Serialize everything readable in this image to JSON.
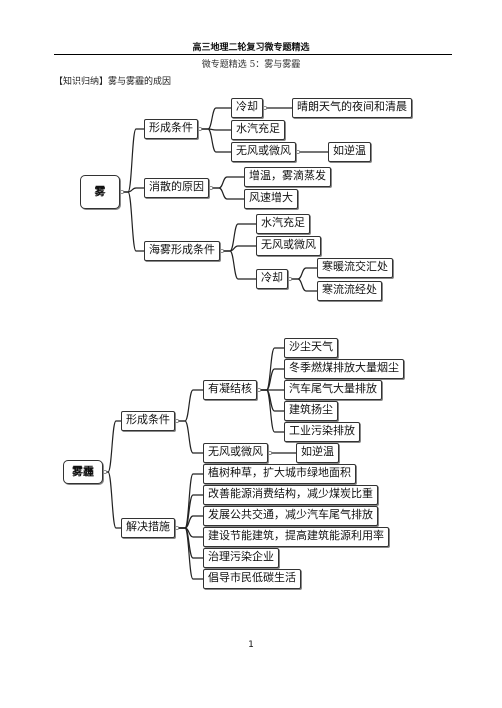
{
  "header": {
    "title": "高三地理二轮复习微专题精选",
    "subtitle": "微专题精选 5：雾与雾霾",
    "section": "【知识归纳】雾与雾霾的成因"
  },
  "fog_map": {
    "root": "雾",
    "branches": [
      {
        "label": "形成条件",
        "children": [
          {
            "label": "冷却",
            "children": [
              {
                "label": "晴朗天气的夜间和清晨"
              }
            ]
          },
          {
            "label": "水汽充足"
          },
          {
            "label": "无风或微风",
            "children": [
              {
                "label": "如逆温"
              }
            ]
          }
        ]
      },
      {
        "label": "消散的原因",
        "children": [
          {
            "label": "增温，雾滴蒸发"
          },
          {
            "label": "风速增大"
          }
        ]
      },
      {
        "label": "海雾形成条件",
        "children": [
          {
            "label": "水汽充足"
          },
          {
            "label": "无风或微风"
          },
          {
            "label": "冷却",
            "children": [
              {
                "label": "寒暖流交汇处"
              },
              {
                "label": "寒流流经处"
              }
            ]
          }
        ]
      }
    ]
  },
  "haze_map": {
    "root": "雾霾",
    "branches": [
      {
        "label": "形成条件",
        "children": [
          {
            "label": "有凝结核",
            "children": [
              {
                "label": "沙尘天气"
              },
              {
                "label": "冬季燃煤排放大量烟尘"
              },
              {
                "label": "汽车尾气大量排放"
              },
              {
                "label": "建筑扬尘"
              },
              {
                "label": "工业污染排放"
              }
            ]
          },
          {
            "label": "无风或微风",
            "children": [
              {
                "label": "如逆温"
              }
            ]
          }
        ]
      },
      {
        "label": "解决措施",
        "children": [
          {
            "label": "植树种草，扩大城市绿地面积"
          },
          {
            "label": "改善能源消费结构，减少煤炭比重"
          },
          {
            "label": "发展公共交通，减少汽车尾气排放"
          },
          {
            "label": "建设节能建筑，提高建筑能源利用率"
          },
          {
            "label": "治理污染企业"
          },
          {
            "label": "倡导市民低碳生活"
          }
        ]
      }
    ]
  },
  "footer": {
    "page_number": "1"
  }
}
